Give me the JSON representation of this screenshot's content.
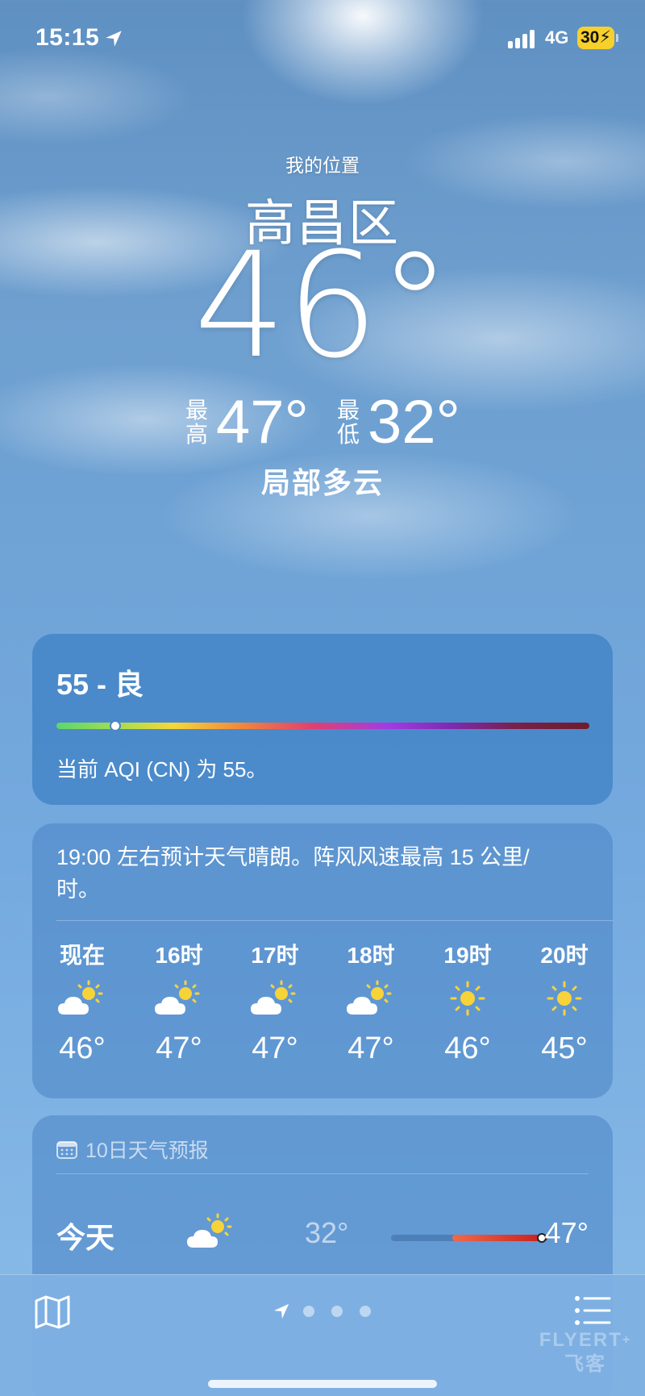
{
  "status_bar": {
    "time": "15:15",
    "network": "4G",
    "battery": "30"
  },
  "header": {
    "my_location": "我的位置",
    "city": "高昌区",
    "temperature": "46°",
    "high_label": "最高",
    "high": "47°",
    "low_label": "最低",
    "low": "32°",
    "condition": "局部多云"
  },
  "aqi": {
    "title": "55 - 良",
    "description": "当前 AQI (CN) 为 55。",
    "level_fraction": 0.11
  },
  "hourly": {
    "summary": "19:00 左右预计天气晴朗。阵风风速最高 15 公里/时。",
    "items": [
      {
        "label": "现在",
        "icon": "partly-cloudy-icon",
        "temp": "46°"
      },
      {
        "label": "16时",
        "icon": "partly-cloudy-icon",
        "temp": "47°"
      },
      {
        "label": "17时",
        "icon": "partly-cloudy-icon",
        "temp": "47°"
      },
      {
        "label": "18时",
        "icon": "partly-cloudy-icon",
        "temp": "47°"
      },
      {
        "label": "19时",
        "icon": "sun-icon",
        "temp": "46°"
      },
      {
        "label": "20时",
        "icon": "sun-icon",
        "temp": "45°"
      }
    ]
  },
  "forecast": {
    "title": "10日天气预报",
    "days": [
      {
        "day": "今天",
        "icon": "partly-cloudy-icon",
        "low": "32°",
        "high": "47°"
      }
    ]
  },
  "colors": {
    "battery": "#f7d02c",
    "card_bg": "#4a84c4",
    "range_fill": "#d63a2a"
  },
  "watermark": {
    "text": "FLYERT",
    "subtext": "飞客"
  }
}
